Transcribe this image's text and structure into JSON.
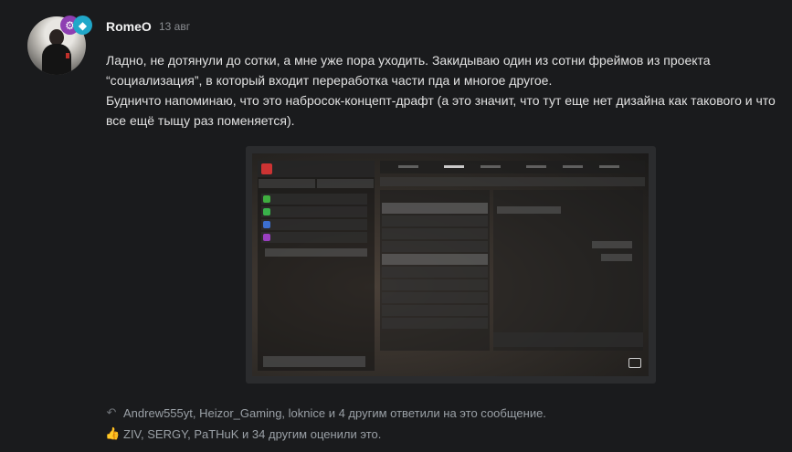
{
  "post": {
    "author": "RomeO",
    "date": "13 авг",
    "lines": [
      "Ладно, не дотянули до сотки, а мне уже пора уходить. Закидываю один из сотни фреймов из проекта",
      "“социализация”, в который входит переработка части пда и многое другое.",
      "Будничто напоминаю, что это набросок-концепт-драфт (а это значит, что тут еще нет дизайна как такового и что",
      "все ещё тыщу раз поменяется)."
    ]
  },
  "icons": {
    "badge_1": "robot-icon",
    "badge_2": "diamond-icon",
    "reply": "reply-arrow-icon",
    "like": "thumbs-up-icon",
    "camera": "image-icon"
  },
  "replies_text": "Andrew555yt, Heizor_Gaming, loknice и 4 другим ответили на это сообщение.",
  "reactions_text": "ZIV, SERGY, PaTHuK и 34 другим оценили это.",
  "colors": {
    "background": "#1a1b1d",
    "badge_purple": "#8e3fb2",
    "badge_cyan": "#20a7c9"
  }
}
